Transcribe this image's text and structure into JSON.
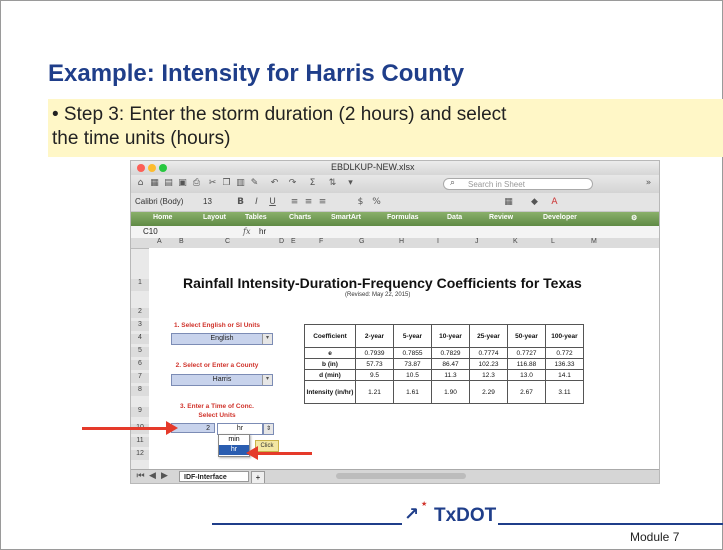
{
  "slide": {
    "title": "Example:  Intensity for Harris County",
    "bullet": "• Step 3: Enter the storm duration (2 hours) and select\n   the time units (hours)",
    "footer_logo": "TxDOT",
    "module_label": "Module 7"
  },
  "excel": {
    "filename": "EBDLKUP-NEW.xlsx",
    "search_placeholder": "Search in Sheet",
    "font_name": "Calibri (Body)",
    "font_size": "13",
    "ribbon_tabs": [
      "Home",
      "Layout",
      "Tables",
      "Charts",
      "SmartArt",
      "Formulas",
      "Data",
      "Review",
      "Developer"
    ],
    "cell_ref": "C10",
    "formula_symbol": "fx",
    "formula_value": "hr",
    "column_headers": [
      "A",
      "B",
      "C",
      "D",
      "E",
      "F",
      "G",
      "H",
      "I",
      "J",
      "K",
      "L",
      "M"
    ],
    "row_numbers": [
      "1",
      "2",
      "3",
      "4",
      "5",
      "6",
      "7",
      "8",
      "9",
      "10",
      "11",
      "12"
    ],
    "sheet_title": "Rainfall Intensity-Duration-Frequency Coefficients for Texas",
    "sheet_subtitle": "(Revised: May 22, 2015)",
    "step1_label": "1. Select English or SI Units",
    "units_value": "English",
    "step2_label": "2. Select or Enter a County",
    "county_value": "Harris",
    "step3_label": "3. Enter a Time of Conc.",
    "step3_sub": "Select Units",
    "duration_value": "2",
    "time_unit_value": "hr",
    "unit_options": [
      "min",
      "hr"
    ],
    "click_tip": "Click",
    "sheet_tab": "IDF-Interface",
    "table": {
      "headers": [
        "Coefficient",
        "2-year",
        "5-year",
        "10-year",
        "25-year",
        "50-year",
        "100-year"
      ],
      "rows": [
        [
          "e",
          "0.7939",
          "0.7855",
          "0.7829",
          "0.7774",
          "0.7727",
          "0.772"
        ],
        [
          "b (in)",
          "57.73",
          "73.87",
          "86.47",
          "102.23",
          "116.88",
          "136.33"
        ],
        [
          "d (min)",
          "9.5",
          "10.5",
          "11.3",
          "12.3",
          "13.0",
          "14.1"
        ],
        [
          "Intensity (in/hr)",
          "1.21",
          "1.61",
          "1.90",
          "2.29",
          "2.67",
          "3.11"
        ]
      ]
    }
  },
  "colors": {
    "title_blue": "#1f3e8a",
    "bullet_bg": "#fff7c7",
    "arrow_red": "#e53a2a",
    "ribbon_green": "#6e9a52",
    "label_red": "#d0332b"
  }
}
